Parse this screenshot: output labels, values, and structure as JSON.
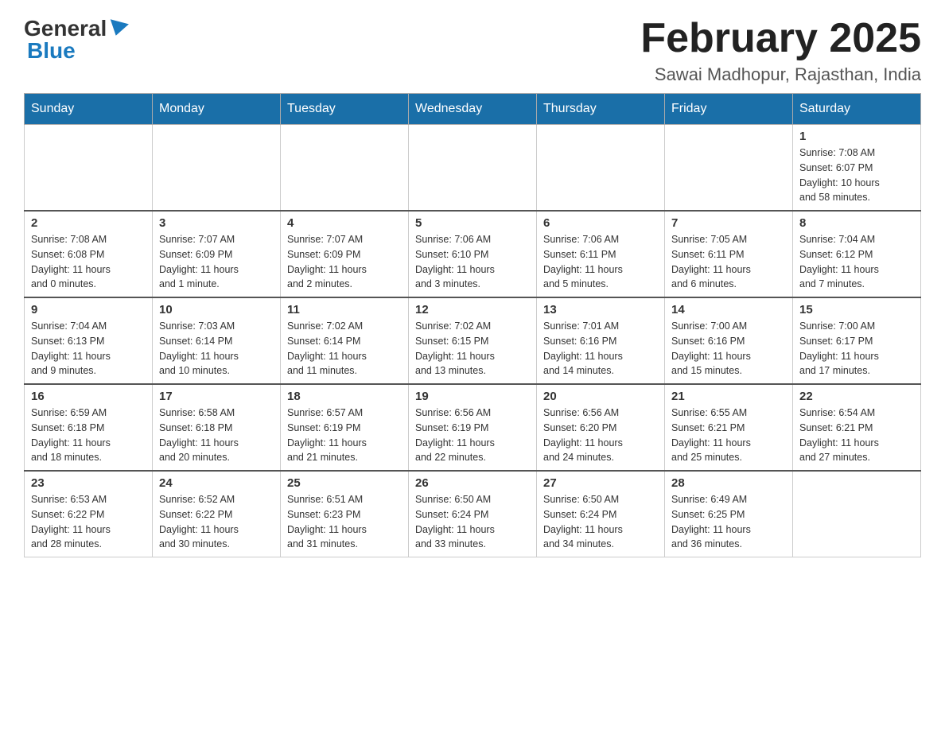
{
  "header": {
    "logo_general": "General",
    "logo_blue": "Blue",
    "month_title": "February 2025",
    "location": "Sawai Madhopur, Rajasthan, India"
  },
  "weekdays": [
    "Sunday",
    "Monday",
    "Tuesday",
    "Wednesday",
    "Thursday",
    "Friday",
    "Saturday"
  ],
  "weeks": [
    [
      {
        "day": "",
        "info": ""
      },
      {
        "day": "",
        "info": ""
      },
      {
        "day": "",
        "info": ""
      },
      {
        "day": "",
        "info": ""
      },
      {
        "day": "",
        "info": ""
      },
      {
        "day": "",
        "info": ""
      },
      {
        "day": "1",
        "info": "Sunrise: 7:08 AM\nSunset: 6:07 PM\nDaylight: 10 hours\nand 58 minutes."
      }
    ],
    [
      {
        "day": "2",
        "info": "Sunrise: 7:08 AM\nSunset: 6:08 PM\nDaylight: 11 hours\nand 0 minutes."
      },
      {
        "day": "3",
        "info": "Sunrise: 7:07 AM\nSunset: 6:09 PM\nDaylight: 11 hours\nand 1 minute."
      },
      {
        "day": "4",
        "info": "Sunrise: 7:07 AM\nSunset: 6:09 PM\nDaylight: 11 hours\nand 2 minutes."
      },
      {
        "day": "5",
        "info": "Sunrise: 7:06 AM\nSunset: 6:10 PM\nDaylight: 11 hours\nand 3 minutes."
      },
      {
        "day": "6",
        "info": "Sunrise: 7:06 AM\nSunset: 6:11 PM\nDaylight: 11 hours\nand 5 minutes."
      },
      {
        "day": "7",
        "info": "Sunrise: 7:05 AM\nSunset: 6:11 PM\nDaylight: 11 hours\nand 6 minutes."
      },
      {
        "day": "8",
        "info": "Sunrise: 7:04 AM\nSunset: 6:12 PM\nDaylight: 11 hours\nand 7 minutes."
      }
    ],
    [
      {
        "day": "9",
        "info": "Sunrise: 7:04 AM\nSunset: 6:13 PM\nDaylight: 11 hours\nand 9 minutes."
      },
      {
        "day": "10",
        "info": "Sunrise: 7:03 AM\nSunset: 6:14 PM\nDaylight: 11 hours\nand 10 minutes."
      },
      {
        "day": "11",
        "info": "Sunrise: 7:02 AM\nSunset: 6:14 PM\nDaylight: 11 hours\nand 11 minutes."
      },
      {
        "day": "12",
        "info": "Sunrise: 7:02 AM\nSunset: 6:15 PM\nDaylight: 11 hours\nand 13 minutes."
      },
      {
        "day": "13",
        "info": "Sunrise: 7:01 AM\nSunset: 6:16 PM\nDaylight: 11 hours\nand 14 minutes."
      },
      {
        "day": "14",
        "info": "Sunrise: 7:00 AM\nSunset: 6:16 PM\nDaylight: 11 hours\nand 15 minutes."
      },
      {
        "day": "15",
        "info": "Sunrise: 7:00 AM\nSunset: 6:17 PM\nDaylight: 11 hours\nand 17 minutes."
      }
    ],
    [
      {
        "day": "16",
        "info": "Sunrise: 6:59 AM\nSunset: 6:18 PM\nDaylight: 11 hours\nand 18 minutes."
      },
      {
        "day": "17",
        "info": "Sunrise: 6:58 AM\nSunset: 6:18 PM\nDaylight: 11 hours\nand 20 minutes."
      },
      {
        "day": "18",
        "info": "Sunrise: 6:57 AM\nSunset: 6:19 PM\nDaylight: 11 hours\nand 21 minutes."
      },
      {
        "day": "19",
        "info": "Sunrise: 6:56 AM\nSunset: 6:19 PM\nDaylight: 11 hours\nand 22 minutes."
      },
      {
        "day": "20",
        "info": "Sunrise: 6:56 AM\nSunset: 6:20 PM\nDaylight: 11 hours\nand 24 minutes."
      },
      {
        "day": "21",
        "info": "Sunrise: 6:55 AM\nSunset: 6:21 PM\nDaylight: 11 hours\nand 25 minutes."
      },
      {
        "day": "22",
        "info": "Sunrise: 6:54 AM\nSunset: 6:21 PM\nDaylight: 11 hours\nand 27 minutes."
      }
    ],
    [
      {
        "day": "23",
        "info": "Sunrise: 6:53 AM\nSunset: 6:22 PM\nDaylight: 11 hours\nand 28 minutes."
      },
      {
        "day": "24",
        "info": "Sunrise: 6:52 AM\nSunset: 6:22 PM\nDaylight: 11 hours\nand 30 minutes."
      },
      {
        "day": "25",
        "info": "Sunrise: 6:51 AM\nSunset: 6:23 PM\nDaylight: 11 hours\nand 31 minutes."
      },
      {
        "day": "26",
        "info": "Sunrise: 6:50 AM\nSunset: 6:24 PM\nDaylight: 11 hours\nand 33 minutes."
      },
      {
        "day": "27",
        "info": "Sunrise: 6:50 AM\nSunset: 6:24 PM\nDaylight: 11 hours\nand 34 minutes."
      },
      {
        "day": "28",
        "info": "Sunrise: 6:49 AM\nSunset: 6:25 PM\nDaylight: 11 hours\nand 36 minutes."
      },
      {
        "day": "",
        "info": ""
      }
    ]
  ]
}
